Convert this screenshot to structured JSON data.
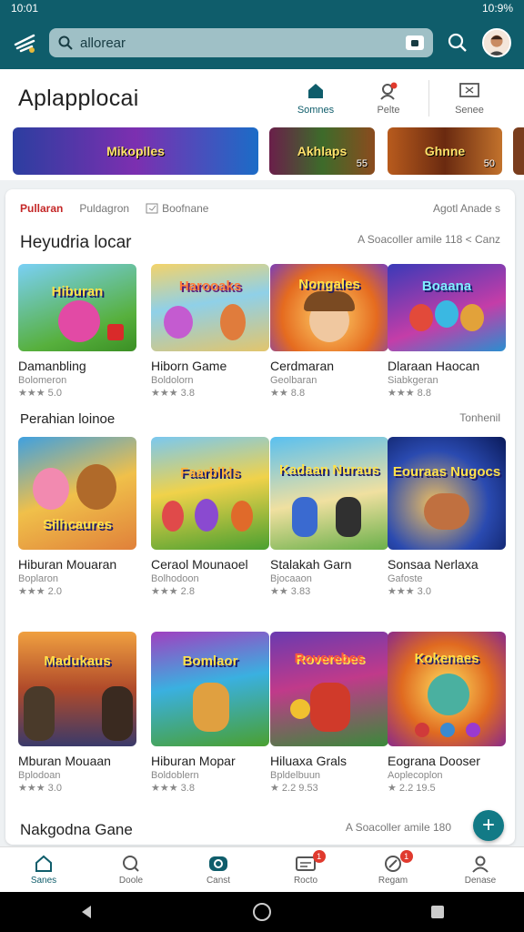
{
  "status": {
    "time": "10:01",
    "right": "10:9%"
  },
  "topbar": {
    "search_text": "allorear"
  },
  "header": {
    "title": "Aplapplocai",
    "tabs": [
      {
        "label": "Somnes",
        "icon": "home-icon"
      },
      {
        "label": "Pelte",
        "icon": "person-alert-icon"
      },
      {
        "label": "Senee",
        "icon": "screen-icon"
      }
    ]
  },
  "banners": [
    {
      "title": "Mikoplles",
      "sub": ""
    },
    {
      "title": "Akhlaps",
      "sub": "55"
    },
    {
      "title": "Ghnne",
      "sub": "50"
    }
  ],
  "filters": {
    "tab1": "Pullaran",
    "tab2": "Puldagron",
    "tab3": "Boofnane",
    "right": "Agotl Anade s"
  },
  "section1": {
    "title": "Heyudria locar",
    "meta": "A Soacoller amile 118  < Canz",
    "items": [
      {
        "title": "Hiburan",
        "name": "Damanbling",
        "dev": "Bolomeron",
        "rating": "★★★ 5.0"
      },
      {
        "title": "Harooaks",
        "name": "Hiborn Game",
        "dev": "Boldolorn",
        "rating": "★★★ 3.8"
      },
      {
        "title": "Nongales",
        "name": "Cerdmaran",
        "dev": "Geolbaran",
        "rating": "★★ 8.8"
      },
      {
        "title": "Boaana",
        "name": "Dlaraan Haocan",
        "dev": "Siabkgeran",
        "rating": "★★★ 8.8"
      }
    ]
  },
  "section2": {
    "title": "Perahian loinoe",
    "meta": "Tonhenil",
    "items": [
      {
        "title": "Silhcaures",
        "name": "Hiburan Mouaran",
        "dev": "Boplaron",
        "rating": "★★★ 2.0"
      },
      {
        "title": "Faarblkls",
        "name": "Ceraol Mounaoel",
        "dev": "Bolhodoon",
        "rating": "★★★ 2.8"
      },
      {
        "title": "Kadaan Nuraus",
        "name": "Stalakah Garn",
        "dev": "Bjocaaon",
        "rating": "★★ 3.83"
      },
      {
        "title": "Eouraas Nugocs",
        "name": "Sonsaa Nerlaxa",
        "dev": "Gafoste",
        "rating": "★★★ 3.0"
      }
    ]
  },
  "section3": {
    "items": [
      {
        "title": "Madukaus",
        "name": "Mburan Mouaan",
        "dev": "Bplodoan",
        "rating": "★★★ 3.0"
      },
      {
        "title": "Bomlaor",
        "name": "Hiburan Mopar",
        "dev": "Boldoblern",
        "rating": "★★★ 3.8"
      },
      {
        "title": "Roverebes",
        "name": "Hiluaxa Grals",
        "dev": "Bpldelbuun",
        "rating": "★ 2.2 9.53"
      },
      {
        "title": "Kokenaes",
        "name": "Eograna Dooser",
        "dev": "Aoplecoplon",
        "rating": "★ 2.2 19.5"
      }
    ]
  },
  "section4": {
    "title": "Nakgodna Gane",
    "meta": "A Soacoller amile 180"
  },
  "bottomnav": [
    {
      "label": "Sanes",
      "icon": "home-icon",
      "badge": ""
    },
    {
      "label": "Doole",
      "icon": "search-chat-icon",
      "badge": ""
    },
    {
      "label": "Canst",
      "icon": "gamepad-icon",
      "badge": ""
    },
    {
      "label": "Rocto",
      "icon": "inbox-icon",
      "badge": "1"
    },
    {
      "label": "Regam",
      "icon": "compass-icon",
      "badge": "1"
    },
    {
      "label": "Denase",
      "icon": "user-icon",
      "badge": ""
    }
  ]
}
